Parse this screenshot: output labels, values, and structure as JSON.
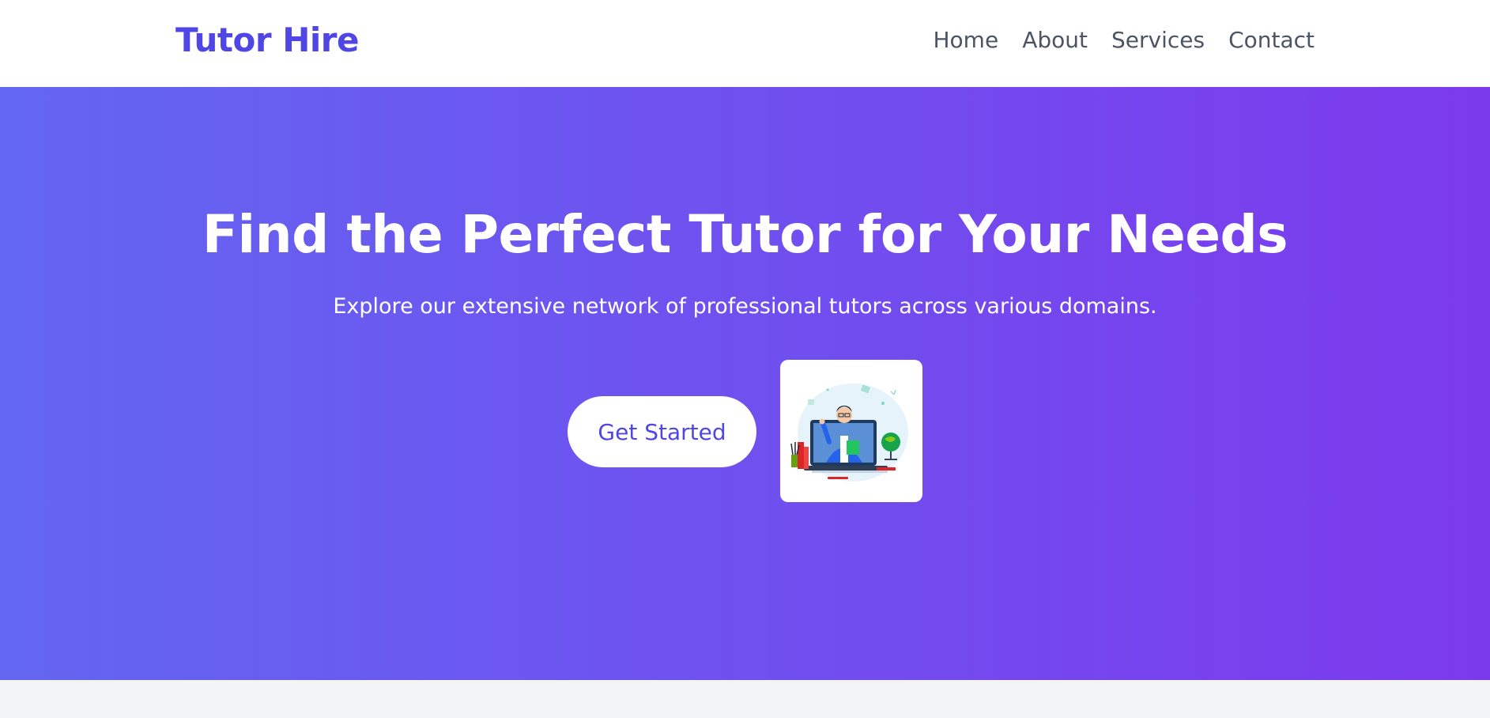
{
  "navbar": {
    "brand": "Tutor Hire",
    "links": [
      {
        "label": "Home"
      },
      {
        "label": "About"
      },
      {
        "label": "Services"
      },
      {
        "label": "Contact"
      }
    ]
  },
  "hero": {
    "title": "Find the Perfect Tutor for Your Needs",
    "subtitle": "Explore our extensive network of professional tutors across various domains.",
    "cta_label": "Get Started",
    "illustration": "online-tutor-illustration"
  },
  "colors": {
    "brand": "#4f46e5",
    "gradient_start": "#6366f1",
    "gradient_end": "#7c3aed",
    "nav_text": "#4b5563",
    "page_bg": "#f3f4f6"
  }
}
